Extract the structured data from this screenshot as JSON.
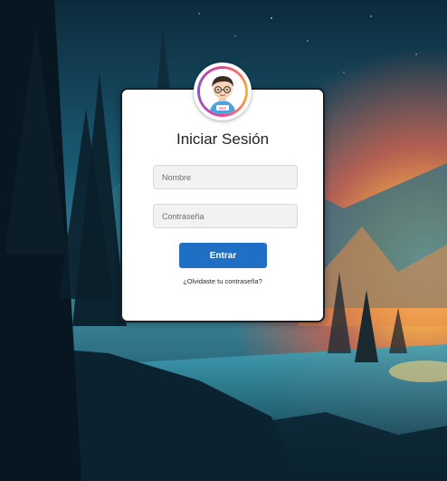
{
  "login": {
    "title": "Iniciar Sesión",
    "username_placeholder": "Nombre",
    "password_placeholder": "Contraseña",
    "submit_label": "Entrar",
    "forgot_link": "¿Olvidaste tu contraseña?"
  },
  "avatar": {
    "shirt_text": "SHT"
  },
  "colors": {
    "button": "#1f6fc5",
    "card": "#ffffff",
    "field_bg": "#f2f2f2"
  }
}
